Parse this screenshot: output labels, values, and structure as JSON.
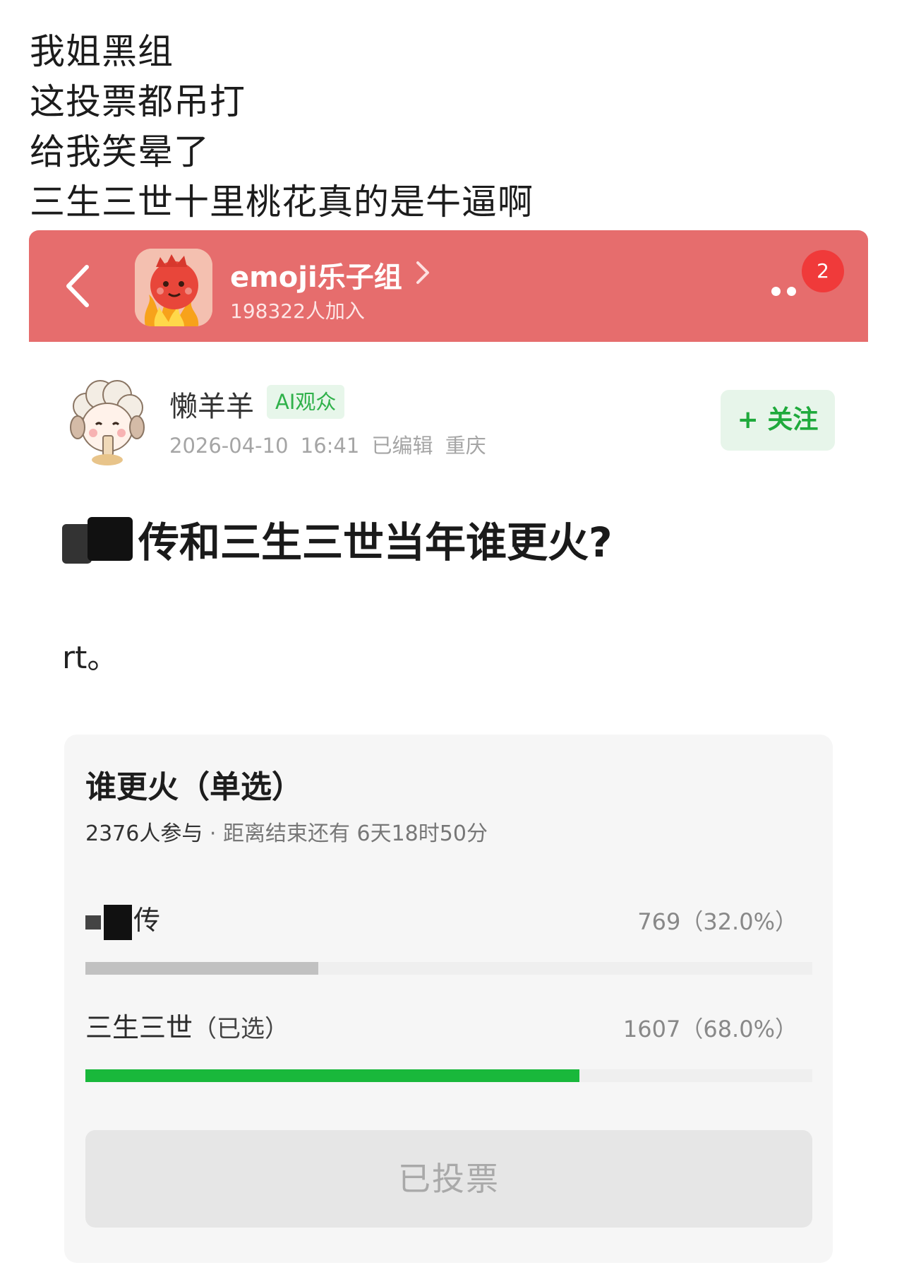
{
  "caption": {
    "lines": [
      "我姐黑组",
      "这投票都吊打",
      "给我笑晕了",
      "三生三世十里桃花真的是牛逼啊"
    ]
  },
  "header": {
    "group_name": "emoji乐子组",
    "member_count": "198322人加入",
    "badge": "2",
    "colors": {
      "background": "#e66d6d",
      "badge": "#f03a3a"
    },
    "icons": [
      "back-arrow-icon",
      "chevron-right-icon",
      "more-dots-icon"
    ]
  },
  "author": {
    "name": "懒羊羊",
    "tag": "AI观众",
    "meta": "2026-04-10 16:41 已编辑 重庆",
    "follow_label": "+ 关注"
  },
  "post": {
    "title": "传和三生三世当年谁更火?",
    "body": "rt。"
  },
  "poll": {
    "title": "谁更火（单选）",
    "participants": "2376人参与",
    "remaining": " · 距离结束还有 6天18时50分",
    "options": [
      {
        "label": "传",
        "result": "769（32.0%）",
        "percent": 32.0,
        "selected": false,
        "bar_color": "#c1c1c1"
      },
      {
        "label": "三生三世",
        "selected_suffix": "（已选）",
        "result": "1607（68.0%）",
        "percent": 68.0,
        "selected": true,
        "bar_color": "#19b83b"
      }
    ],
    "button_label": "已投票"
  }
}
